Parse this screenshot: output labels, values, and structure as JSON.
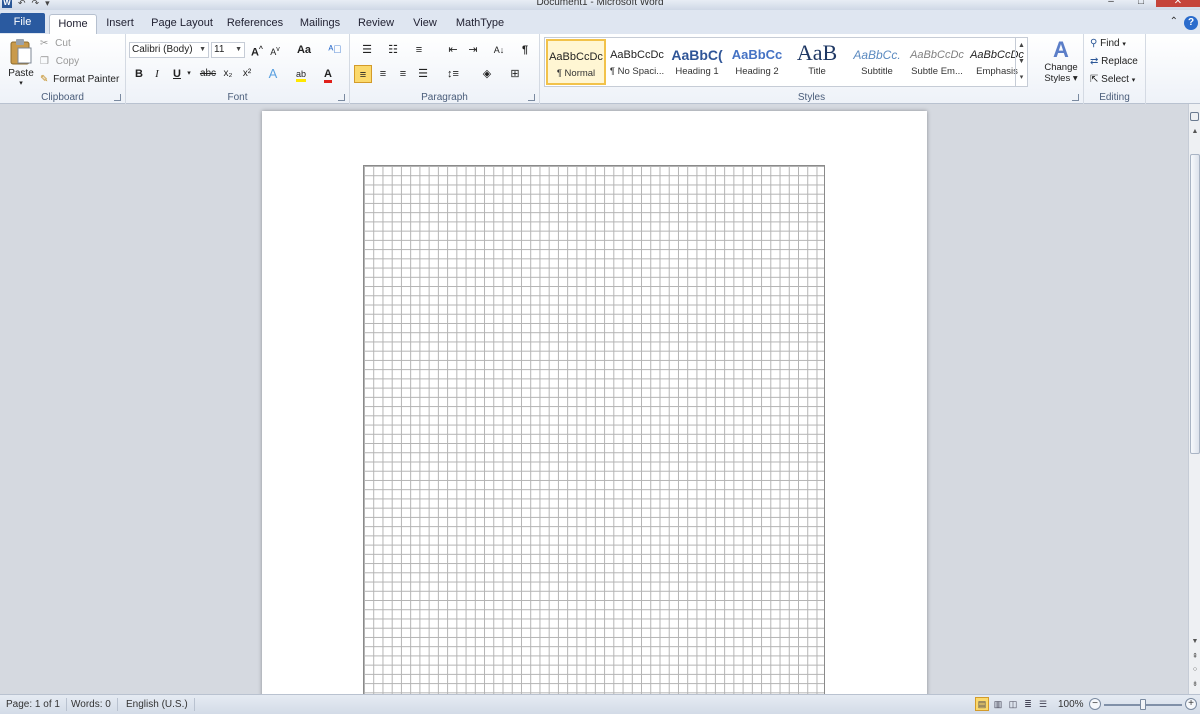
{
  "window": {
    "title": "Document1 - Microsoft Word",
    "minimize": "–",
    "maximize": "□",
    "close": "✕",
    "word_logo": "W",
    "qat_undo": "↶",
    "qat_redo": "↷",
    "qat_menu": "▾"
  },
  "tabs": [
    "File",
    "Home",
    "Insert",
    "Page Layout",
    "References",
    "Mailings",
    "Review",
    "View",
    "MathType"
  ],
  "active_tab": "Home",
  "ribbon": {
    "clipboard": {
      "label": "Clipboard",
      "paste": "Paste",
      "cut": "Cut",
      "copy": "Copy",
      "format_painter": "Format Painter"
    },
    "font": {
      "label": "Font",
      "font_name": "Calibri (Body)",
      "font_size": "11",
      "grow": "A",
      "shrink": "A",
      "change_case": "Aa",
      "bold": "B",
      "italic": "I",
      "underline": "U",
      "strikethrough": "abc",
      "subscript": "x₂",
      "superscript": "x²",
      "text_effects": "A",
      "highlight": "ab",
      "font_color": "A"
    },
    "paragraph": {
      "label": "Paragraph",
      "sort": "A↓",
      "show_marks": "¶"
    },
    "styles": {
      "label": "Styles",
      "items": [
        {
          "preview": "AaBbCcDc",
          "name": "¶ Normal"
        },
        {
          "preview": "AaBbCcDc",
          "name": "¶ No Spaci..."
        },
        {
          "preview": "AaBbC(",
          "name": "Heading 1"
        },
        {
          "preview": "AaBbCc",
          "name": "Heading 2"
        },
        {
          "preview": "AaB",
          "name": "Title"
        },
        {
          "preview": "AaBbCc.",
          "name": "Subtitle"
        },
        {
          "preview": "AaBbCcDc",
          "name": "Subtle Em..."
        },
        {
          "preview": "AaBbCcDc",
          "name": "Emphasis"
        }
      ],
      "change_styles": "Change Styles",
      "change_styles_line1": "Change",
      "change_styles_line2": "Styles"
    },
    "editing": {
      "label": "Editing",
      "find": "Find",
      "replace": "Replace",
      "select": "Select"
    }
  },
  "statusbar": {
    "page": "Page: 1 of 1",
    "words": "Words: 0",
    "language": "English (U.S.)",
    "zoom": "100%",
    "zoom_level": 1.0
  },
  "colors": {
    "file_tab": "#2a5aa0",
    "selected_style": "#f2c24a",
    "heading_blue": "#2f5597",
    "grid_line": "#b3b3b3"
  }
}
